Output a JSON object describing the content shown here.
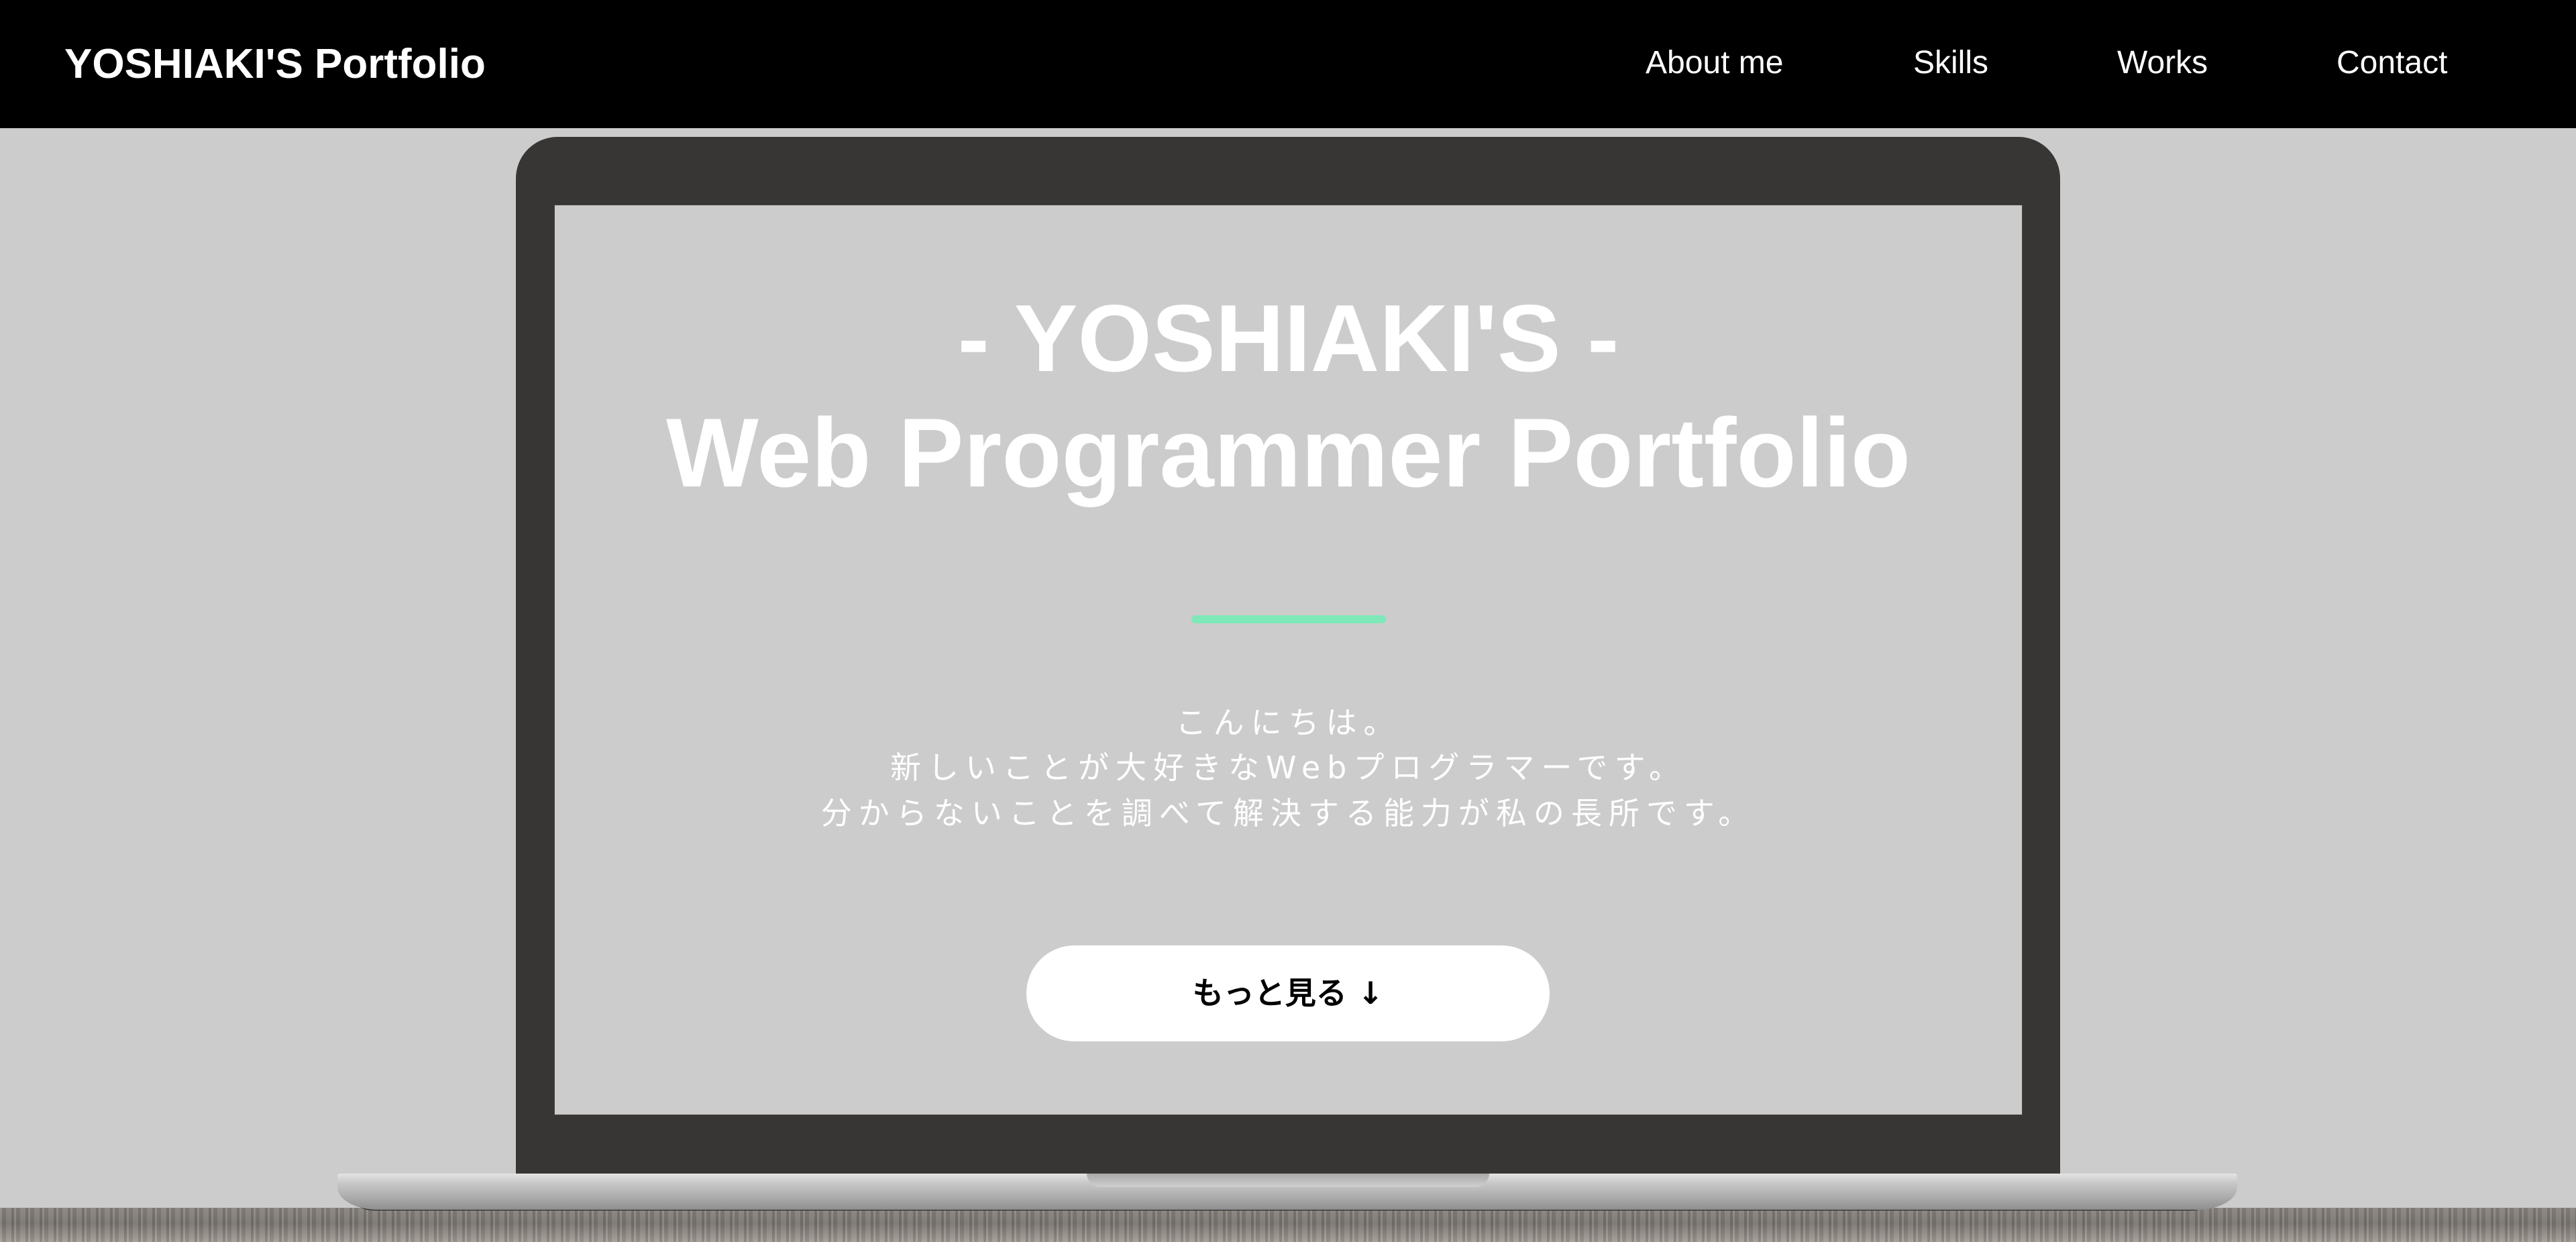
{
  "header": {
    "logo": "YOSHIAKI'S Portfolio",
    "nav": [
      {
        "label": "About me"
      },
      {
        "label": "Skills"
      },
      {
        "label": "Works"
      },
      {
        "label": "Contact"
      }
    ]
  },
  "hero": {
    "title_line1": "- YOSHIAKI'S -",
    "title_line2": "Web Programmer Portfolio",
    "intro": [
      "こんにちは。",
      "新しいことが大好きなWebプログラマーです。",
      "分からないことを調べて解決する能力が私の長所です。"
    ],
    "more_button": "もっと見る ↓"
  },
  "colors": {
    "header_bg": "#000000",
    "page_bg": "#cccccc",
    "accent": "#7ee8b8",
    "laptop_bezel": "#383634",
    "button_bg": "#ffffff"
  }
}
